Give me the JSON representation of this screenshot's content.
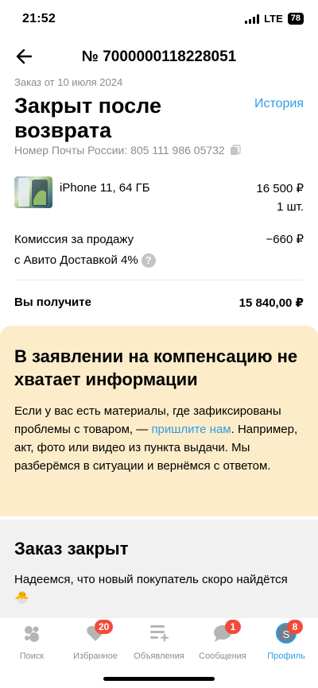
{
  "status_bar": {
    "time": "21:52",
    "network": "LTE",
    "battery": "78"
  },
  "nav": {
    "order_number": "№ 7000000118228051"
  },
  "order": {
    "date": "Заказ от 10 июля 2024",
    "status": "Закрыт после возврата",
    "history_link": "История",
    "tracking": "Номер Почты России: 805 111 986 05732"
  },
  "item": {
    "name": "iPhone 11, 64 ГБ",
    "price": "16 500 ₽",
    "quantity": "1 шт."
  },
  "fee": {
    "label_line1": "Комиссия за продажу",
    "label_line2": "с Авито Доставкой 4%",
    "amount": "−660 ₽",
    "help": "?"
  },
  "total": {
    "label": "Вы получите",
    "amount": "15 840,00 ₽"
  },
  "notice": {
    "title": "В заявлении на компенсацию не хватает информации",
    "text_before": "Если у вас есть материалы, где зафиксированы проблемы с товаром, — ",
    "link": "пришлите нам",
    "text_after": ". Например, акт, фото или видео из пункта выдачи. Мы разберёмся в ситуации и вернёмся с ответом."
  },
  "closed": {
    "title": "Заказ закрыт",
    "text": "Надеемся, что новый покупатель скоро найдётся 🐣"
  },
  "tabbar": {
    "tabs": [
      {
        "label": "Поиск",
        "icon": "search-bubbles-icon"
      },
      {
        "label": "Избранное",
        "icon": "heart-icon",
        "badge": "20"
      },
      {
        "label": "Объявления",
        "icon": "listings-add-icon"
      },
      {
        "label": "Сообщения",
        "icon": "chat-icon",
        "badge": "1"
      },
      {
        "label": "Профиль",
        "icon": "avatar",
        "badge": "8",
        "avatar_letter": "S"
      }
    ]
  },
  "colors": {
    "accent": "#2b9fe6",
    "notice_bg": "#fcecc9",
    "closed_bg": "#f1f1f1",
    "badge": "#f24b3b"
  }
}
